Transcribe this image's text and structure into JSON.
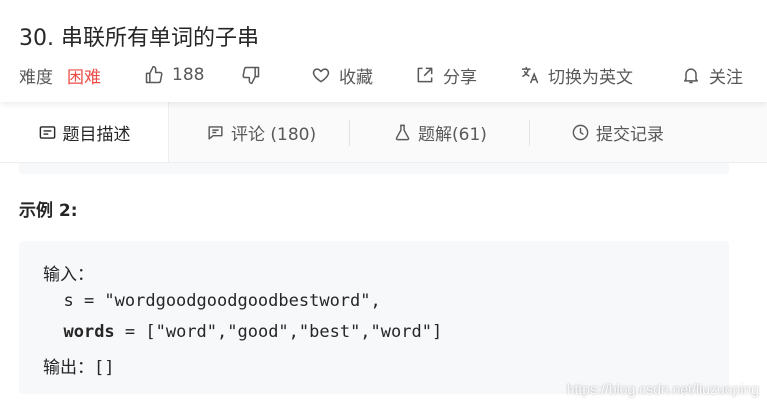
{
  "problem": {
    "title": "30. 串联所有单词的子串",
    "difficulty_label": "难度",
    "difficulty_value": "困难",
    "likes": "188",
    "favorite_label": "收藏",
    "share_label": "分享",
    "switch_lang_label": "切换为英文",
    "follow_label": "关注"
  },
  "tabs": [
    {
      "label": "题目描述"
    },
    {
      "label": "评论 (180)"
    },
    {
      "label": "题解(61)"
    },
    {
      "label": "提交记录"
    }
  ],
  "content": {
    "example_title": "示例 2:",
    "input_label": "输入：",
    "s_line": "  s = \"wordgoodgoodgoodbestword\",",
    "words_key": "words",
    "words_rest": " = [\"word\",\"good\",\"best\",\"word\"]",
    "output_line": "输出：[]"
  },
  "watermark": "https://blog.csdn.net/liuzuoping",
  "colors": {
    "hard": "#ec4c47",
    "text": "#262626",
    "muted": "#595959",
    "code_bg": "#f7f8fa"
  }
}
